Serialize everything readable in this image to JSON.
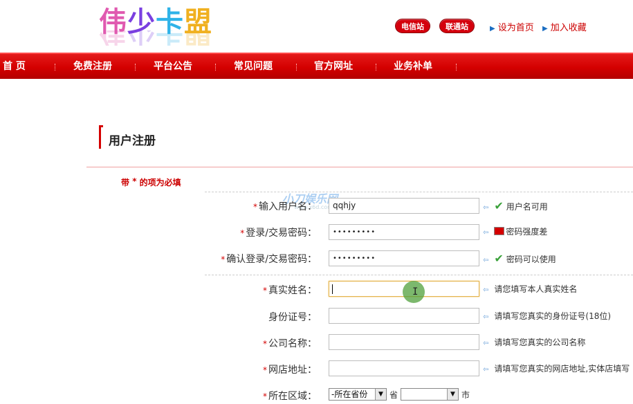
{
  "header": {
    "logo_text": "伟少卡盟",
    "telecom_label": "电信站",
    "unicom_label": "联通站",
    "set_home_label": "设为首页",
    "add_fav_label": "加入收藏"
  },
  "nav": {
    "items": [
      "首 页",
      "免费注册",
      "平台公告",
      "常见问题",
      "官方网址",
      "业务补单"
    ]
  },
  "page": {
    "title": "用户注册",
    "required_note_prefix": "带",
    "required_note_star": "*",
    "required_note_suffix": "的项为必填"
  },
  "watermark": {
    "text": "小刀娱乐网",
    "sub": "www.x6d.com"
  },
  "form": {
    "username": {
      "label": "输入用户名：",
      "value": "qqhjy",
      "hint": "用户名可用",
      "required": "*"
    },
    "password": {
      "label": "登录/交易密码：",
      "value": "•••••••••",
      "hint": "密码强度差",
      "required": "*"
    },
    "confirm": {
      "label": "确认登录/交易密码：",
      "value": "•••••••••",
      "hint": "密码可以使用",
      "required": "*"
    },
    "realname": {
      "label": "真实姓名：",
      "value": "",
      "hint": "请您填写本人真实姓名",
      "required": "*"
    },
    "idcard": {
      "label": "身份证号：",
      "value": "",
      "hint": "请填写您真实的身份证号(18位)"
    },
    "company": {
      "label": "公司名称：",
      "value": "",
      "hint": "请填写您真实的公司名称",
      "required": "*"
    },
    "shop": {
      "label": "网店地址：",
      "value": "",
      "hint": "请填写您真实的网店地址,实体店填写",
      "required": "*"
    },
    "region": {
      "label": "所在区域：",
      "required": "*",
      "province_value": "-所在省份",
      "province_unit": "省",
      "city_value": "",
      "city_unit": "市"
    }
  },
  "icons": {
    "hint_arrow": "arrow-left-icon",
    "check": "check-icon",
    "strength_bar": "strength-bar-icon",
    "dropdown": "dropdown-arrow-icon"
  },
  "colors": {
    "brand_red": "#d40000",
    "check_green": "#3aa13a",
    "hint_blue": "#6aa0d8"
  }
}
